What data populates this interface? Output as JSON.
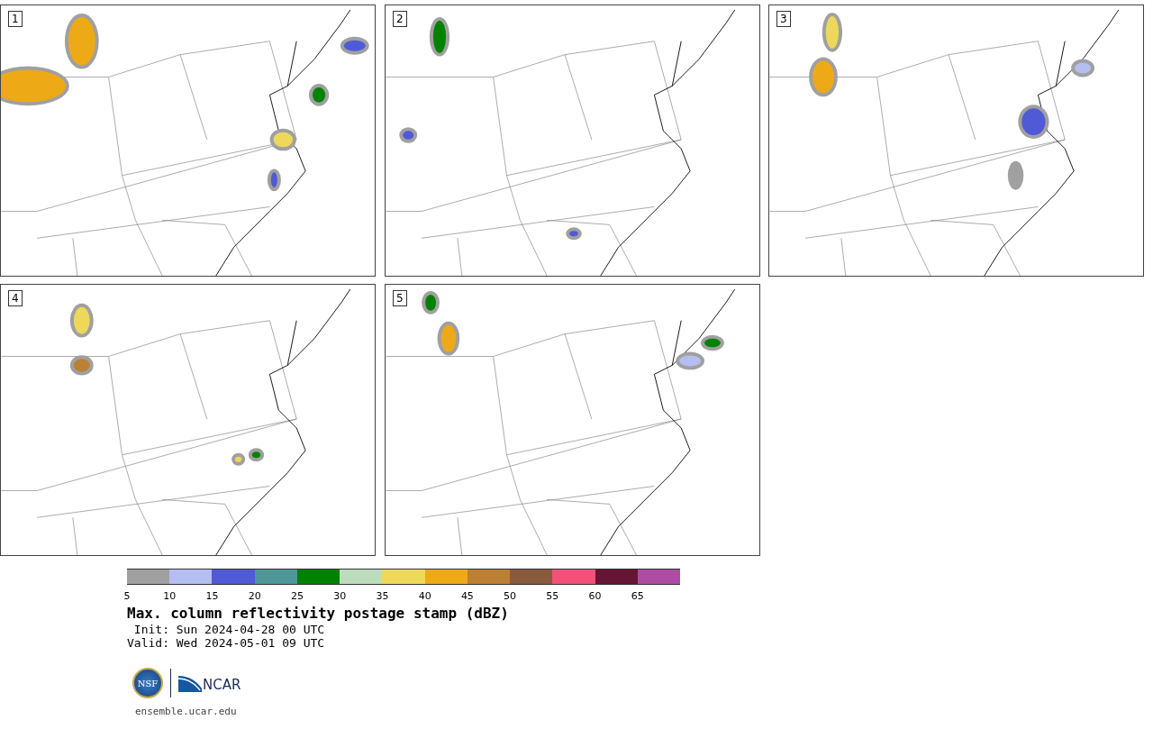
{
  "panels": [
    {
      "label": "1"
    },
    {
      "label": "2"
    },
    {
      "label": "3"
    },
    {
      "label": "4"
    },
    {
      "label": "5"
    }
  ],
  "colorbar": {
    "bins": [
      {
        "color": "#a0a0a0"
      },
      {
        "color": "#b4bef0"
      },
      {
        "color": "#505ad6"
      },
      {
        "color": "#4e9698"
      },
      {
        "color": "#008200"
      },
      {
        "color": "#bcdcbc"
      },
      {
        "color": "#eed85a"
      },
      {
        "color": "#eeaa16"
      },
      {
        "color": "#bb8034"
      },
      {
        "color": "#8a5a3c"
      },
      {
        "color": "#f4507a"
      },
      {
        "color": "#641634"
      },
      {
        "color": "#ae4ca4"
      }
    ],
    "ticks": [
      "5",
      "10",
      "15",
      "20",
      "25",
      "30",
      "35",
      "40",
      "45",
      "50",
      "55",
      "60",
      "65"
    ]
  },
  "title": "Max. column reflectivity postage stamp (dBZ)",
  "init": " Init: Sun 2024-04-28 00 UTC",
  "valid": "Valid: Wed 2024-05-01 09 UTC",
  "logos": {
    "nsf": "NSF",
    "ncar": "NCAR"
  },
  "footer": "ensemble.ucar.edu"
}
